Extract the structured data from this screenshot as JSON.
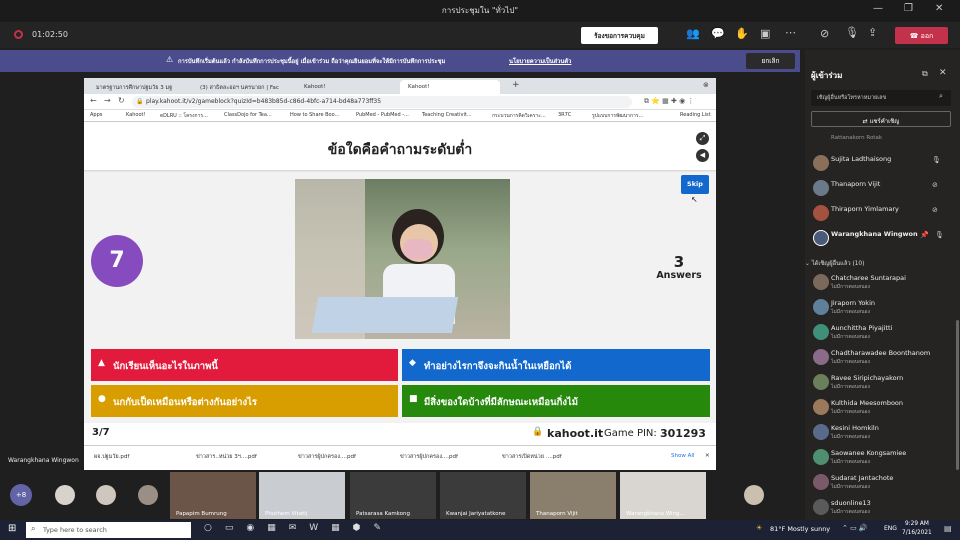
{
  "window": {
    "title": "การประชุมใน \"ทั่วไป\""
  },
  "meeting_bar": {
    "timer": "01:02:50",
    "request_control": "ร้องขอการควบคุม",
    "leave": "ออก"
  },
  "banner": {
    "text": "การบันทึกเริ่มต้นแล้ว  กำลังบันทึกการประชุมนี้อยู่ เมื่อเข้าร่วม ถือว่าคุณยินยอมที่จะให้มีการบันทึกการประชุม",
    "link": "นโยบายความเป็นส่วนตัว",
    "dismiss": "ยกเลิก"
  },
  "browser": {
    "tabs": [
      "มาตรฐานการศึกษาปฐมวัย 3 มฐ",
      "(3) สาธิตละออฯ นครนายก | Fac",
      "Kahoot!",
      "Kahoot!"
    ],
    "url": "play.kahoot.it/v2/gameblock?quizId=b483b85d-c86d-4bfc-a714-bd48a773ff35",
    "bookmarks": [
      "Apps",
      "Kahoot!",
      "eDLRU :: โครงการ...",
      "ClassDojo for Tea...",
      "How to Share Boo...",
      "PubMed - PubMed -...",
      "Teaching Creativit...",
      "กระบวนการคิดวิเคราะ...",
      "3R7C",
      "รูปแบบการพัฒนาการ..."
    ],
    "reading_list": "Reading List"
  },
  "kahoot": {
    "question": "ข้อใดคือคำถามระดับต่ำ",
    "timer": "7",
    "answers_count": "3",
    "answers_label": "Answers",
    "skip": "Skip",
    "progress": "3/7",
    "brand": "kahoot.it",
    "pin_label": "Game PIN:",
    "pin": "301293",
    "choices": [
      {
        "text": "นักเรียนเห็นอะไรในภาพนี้",
        "color": "#e21b3c",
        "shape": "▲"
      },
      {
        "text": "ทำอย่างไรกาจึงจะกินน้ำในเหยือกได้",
        "color": "#1368ce",
        "shape": "◆"
      },
      {
        "text": "นกกับเป็ดเหมือนหรือต่างกันอย่างไร",
        "color": "#d89e00",
        "shape": "●"
      },
      {
        "text": "มีสิ่งของใดบ้างที่มีลักษณะเหมือนกิ่งไม้",
        "color": "#26890c",
        "shape": "■"
      }
    ]
  },
  "downloads": {
    "items": [
      "ผจ.ปฐมวัย.pdf",
      "ข่าวสาร..หน่วย 3ฯ....pdf",
      "ข่าวสารผู้ปกครอง....pdf",
      "ข่าวสารผู้ปกครอง....pdf",
      "ข่าวสารเปิดหน่วย ....pdf"
    ],
    "show_all": "Show All"
  },
  "presenter_label": "Warangkhana Wingwon",
  "sidebar": {
    "title": "ผู้เข้าร่วม",
    "search_placeholder": "เชิญผู้อื่นหรือโทรหาหมายเลข",
    "share_invite": "แชร์คำเชิญ",
    "partial_top": "Rattanakorn Rotak",
    "in_meeting": [
      "Sujita Ladthaisong",
      "Thanaporn Vijit",
      "Thiraporn Yimlamary",
      "Warangkhana Wingwon"
    ],
    "suggested_header": "ได้เชิญผู้อื่นแล้ว (10)",
    "suggested_sub": "ไม่มีการตอบสนอง",
    "suggested": [
      "Chatcharee Suntarapai",
      "Jiraporn Yokin",
      "Aunchittha Piyajitti",
      "Chadtharawadee Boonthanom",
      "Ravee Siripichayakorn",
      "Kulthida Meesomboon",
      "Kesini Homkiln",
      "Saowanee Kongsamiee",
      "Sudarat Jantachote",
      "sduonline13"
    ]
  },
  "strip": {
    "more": "+8",
    "tiles": [
      "Papapim Bumrung",
      "Phuthem Vitatij",
      "Patsarasa Kamkong",
      "Kwanjai Jariyatatkone",
      "Thanaporn Vijit",
      "Warangkhana Wing..."
    ]
  },
  "taskbar": {
    "search": "Type here to search",
    "weather": "81°F  Mostly sunny",
    "lang": "ENG",
    "time": "9:29 AM",
    "date": "7/16/2021"
  }
}
